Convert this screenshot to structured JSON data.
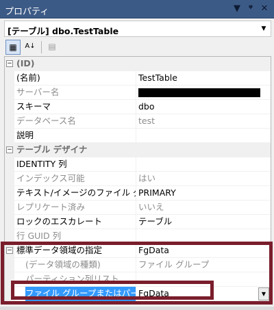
{
  "window": {
    "title": "プロパティ",
    "pin_symbol": "ᵠ",
    "close_symbol": "✕",
    "menu_symbol": "▼"
  },
  "selector": {
    "label": "[テーブル] dbo.TestTable",
    "arrow": "▼"
  },
  "toolbar": {
    "categorized_symbol": "▦",
    "alphabetical_symbol": "A↓",
    "property_pages_symbol": "▤"
  },
  "grid": {
    "categories": [
      {
        "label": "(ID)",
        "toggle": "−"
      },
      {
        "label": "テーブル デザイナ",
        "toggle": "−"
      }
    ],
    "rows": [
      {
        "name": "(名前)",
        "value": "TestTable",
        "disabled": false
      },
      {
        "name": "サーバー名",
        "value": "",
        "disabled": true,
        "redacted": true
      },
      {
        "name": "スキーマ",
        "value": "dbo",
        "disabled": false
      },
      {
        "name": "データベース名",
        "value": "test",
        "disabled": true
      },
      {
        "name": "説明",
        "value": "",
        "disabled": false
      },
      {
        "name": "IDENTITY 列",
        "value": "",
        "disabled": false
      },
      {
        "name": "インデックス可能",
        "value": "はい",
        "disabled": true
      },
      {
        "name": "テキスト/イメージのファイル グ",
        "value": "PRIMARY",
        "disabled": false
      },
      {
        "name": "レプリケート済み",
        "value": "いいえ",
        "disabled": true
      },
      {
        "name": "ロックのエスカレート",
        "value": "テーブル",
        "disabled": false
      },
      {
        "name": "行 GUID 列",
        "value": "",
        "disabled": true
      },
      {
        "name": "標準データ領域の指定",
        "value": "FgData",
        "disabled": false,
        "toggle": "−"
      },
      {
        "name": "(データ領域の種類)",
        "value": "ファイル グループ",
        "disabled": true
      },
      {
        "name": "パーティション列リスト",
        "value": "",
        "disabled": true
      },
      {
        "name": "ファイル グループまたはパーティ",
        "value": "FgData",
        "disabled": false,
        "selected": true,
        "dropdown": "▼"
      }
    ]
  },
  "colors": {
    "titlebar": "#3c5a86",
    "selection": "#3399ff",
    "highlight_box": "#7a1e2c",
    "disabled_text": "#8c8c8c"
  }
}
